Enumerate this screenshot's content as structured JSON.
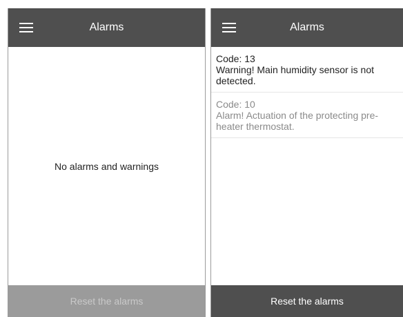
{
  "left_screen": {
    "title": "Alarms",
    "menu_icon": "hamburger-menu-icon",
    "empty_message": "No alarms and warnings",
    "reset_label": "Reset the alarms",
    "reset_enabled": false
  },
  "right_screen": {
    "title": "Alarms",
    "menu_icon": "hamburger-menu-icon",
    "alarms": [
      {
        "code": "Code: 13",
        "message": "Warning! Main humidity sensor is not detected.",
        "state": "current"
      },
      {
        "code": "Code: 10",
        "message": "Alarm! Actuation of the protecting pre-heater thermostat.",
        "state": "past"
      }
    ],
    "reset_label": "Reset the alarms",
    "reset_enabled": true
  },
  "colors": {
    "appbar": "#4f4f4f",
    "reset_disabled_bg": "#9b9b9b",
    "reset_disabled_text": "#c9c9c9",
    "reset_active_bg": "#4f4f4f",
    "alarm_current_text": "#1f1f1f",
    "alarm_past_text": "#8a8a8a"
  }
}
